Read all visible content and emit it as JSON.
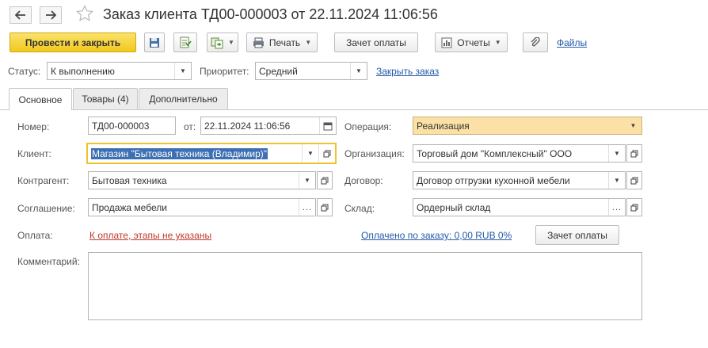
{
  "window": {
    "title": "Заказ клиента ТД00-000003 от 22.11.2024 11:06:56"
  },
  "toolbar": {
    "post_close": "Провести и закрыть",
    "print": "Печать",
    "payment_offset": "Зачет оплаты",
    "reports": "Отчеты",
    "files": "Файлы"
  },
  "status": {
    "label": "Статус:",
    "value": "К выполнению",
    "priority_label": "Приоритет:",
    "priority_value": "Средний",
    "close_order_link": "Закрыть заказ"
  },
  "tabs": [
    {
      "label": "Основное"
    },
    {
      "label": "Товары (4)"
    },
    {
      "label": "Дополнительно"
    }
  ],
  "form": {
    "number_label": "Номер:",
    "number_value": "ТД00-000003",
    "from_label": "от:",
    "date_value": "22.11.2024 11:06:56",
    "operation_label": "Операция:",
    "operation_value": "Реализация",
    "client_label": "Клиент:",
    "client_value": "Магазин \"Бытовая техника (Владимир)\"",
    "organization_label": "Организация:",
    "organization_value": "Торговый дом \"Комплексный\" ООО",
    "counterparty_label": "Контрагент:",
    "counterparty_value": "Бытовая техника",
    "contract_label": "Договор:",
    "contract_value": "Договор отгрузки кухонной мебели",
    "agreement_label": "Соглашение:",
    "agreement_value": "Продажа мебели",
    "warehouse_label": "Склад:",
    "warehouse_value": "Ордерный склад",
    "payment_label": "Оплата:",
    "payment_link": "К оплате, этапы не указаны",
    "paid_link": "Оплачено по заказу: 0,00 RUB 0%",
    "payment_offset_button": "Зачет оплаты",
    "comment_label": "Комментарий:",
    "comment_value": ""
  },
  "colors": {
    "primary_button": "#f2c81c",
    "focus_border": "#f0c22e",
    "operation_bg": "#fbe1a6",
    "link": "#2459a8",
    "error_link": "#c0392b",
    "selection": "#3d6fb3"
  }
}
